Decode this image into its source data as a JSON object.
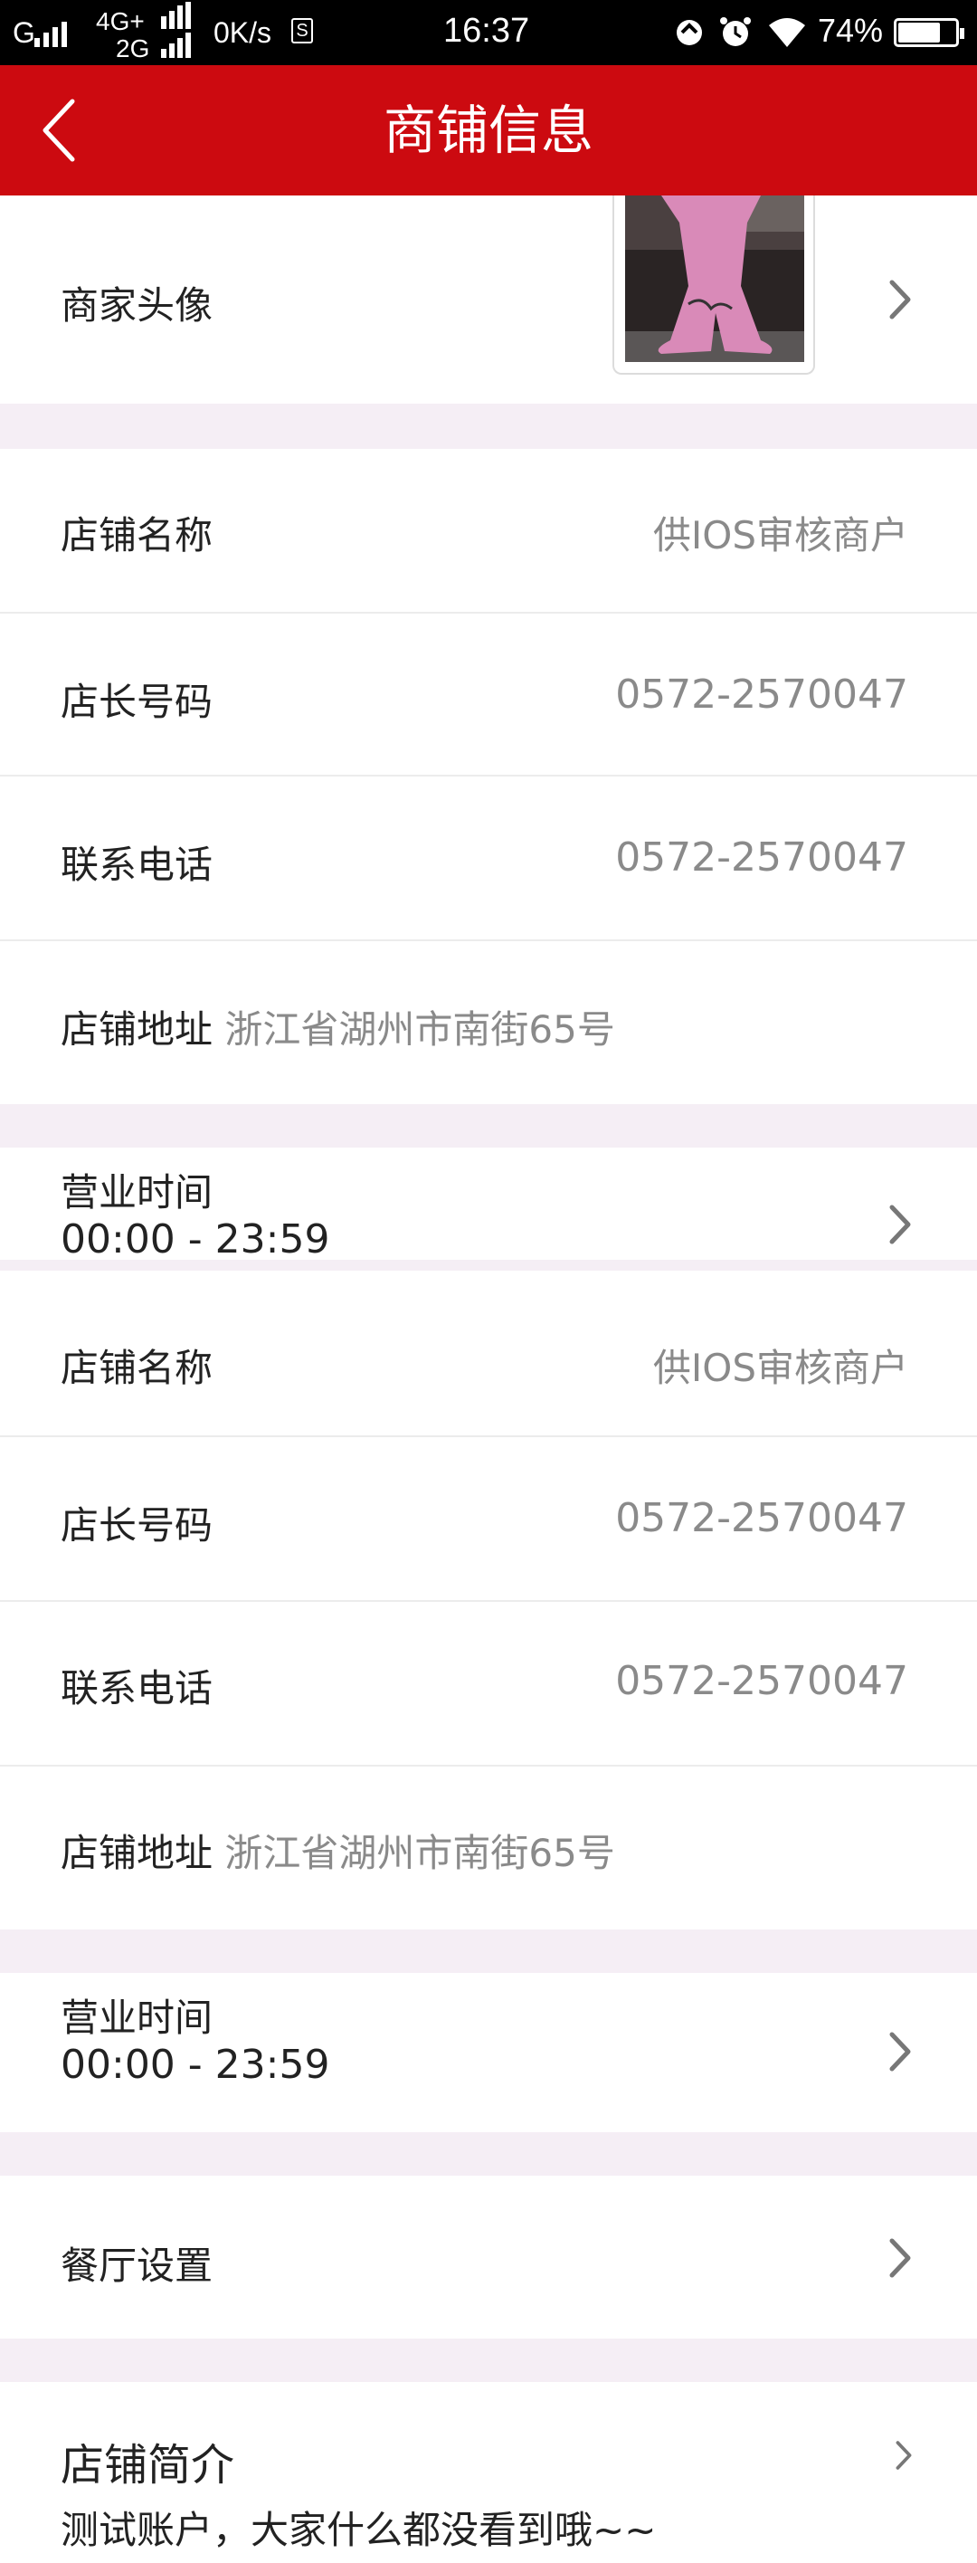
{
  "status_bar": {
    "network1": "G",
    "network2_top": "4G+",
    "network2_bottom": "2G",
    "speed": "0K/s",
    "storage_badge": "S",
    "time": "16:37",
    "battery_percent": "74%",
    "battery_level": 0.74,
    "icons": [
      "signal-icon",
      "speed-icon",
      "sync-icon",
      "alarm-icon",
      "wifi-icon",
      "battery-icon"
    ]
  },
  "nav": {
    "title": "商铺信息",
    "back_icon": "chevron-left-icon"
  },
  "avatar_row": {
    "label": "商家头像"
  },
  "section1": {
    "shop_name": {
      "label": "店铺名称",
      "value": "供IOS审核商户"
    },
    "manager_phone": {
      "label": "店长号码",
      "value": "0572-2570047"
    },
    "contact_phone": {
      "label": "联系电话",
      "value": "0572-2570047"
    },
    "address": {
      "label": "店铺地址",
      "value": "浙江省湖州市南街65号"
    },
    "hours": {
      "label": "营业时间",
      "value": "00:00 - 23:59"
    }
  },
  "section2": {
    "shop_name": {
      "label": "店铺名称",
      "value": "供IOS审核商户"
    },
    "manager_phone": {
      "label": "店长号码",
      "value": "0572-2570047"
    },
    "contact_phone": {
      "label": "联系电话",
      "value": "0572-2570047"
    },
    "address": {
      "label": "店铺地址",
      "value": "浙江省湖州市南街65号"
    },
    "hours": {
      "label": "营业时间",
      "value": "00:00 - 23:59"
    }
  },
  "restaurant_settings": {
    "label": "餐厅设置"
  },
  "intro": {
    "title": "店铺简介",
    "text": "测试账户，大家什么都没看到哦~~"
  },
  "colors": {
    "nav_bg": "#cc0a10",
    "page_bg": "#f5eef5",
    "value_text": "#8a8a8a",
    "label_text": "#222222"
  }
}
